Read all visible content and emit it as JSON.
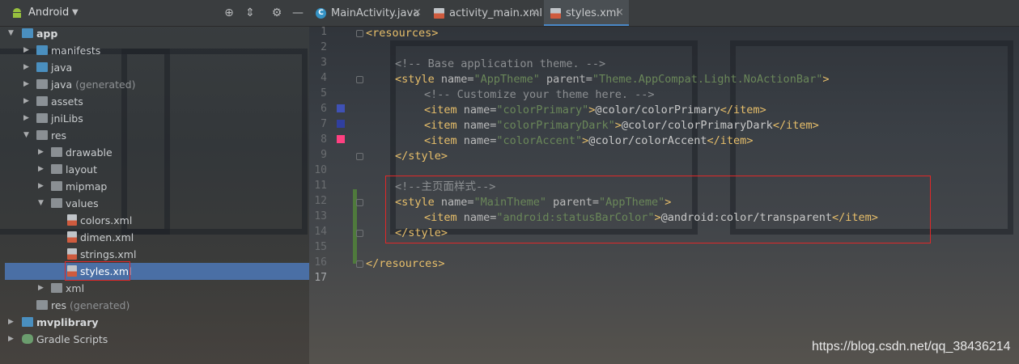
{
  "project_panel": {
    "view_label": "Android",
    "tree": [
      {
        "label": "app",
        "suffix": "",
        "bold": true
      },
      {
        "label": "manifests",
        "suffix": ""
      },
      {
        "label": "java",
        "suffix": ""
      },
      {
        "label": "java",
        "suffix": " (generated)"
      },
      {
        "label": "assets",
        "suffix": ""
      },
      {
        "label": "jniLibs",
        "suffix": ""
      },
      {
        "label": "res",
        "suffix": ""
      },
      {
        "label": "drawable",
        "suffix": ""
      },
      {
        "label": "layout",
        "suffix": ""
      },
      {
        "label": "mipmap",
        "suffix": ""
      },
      {
        "label": "values",
        "suffix": ""
      },
      {
        "label": "colors.xml",
        "suffix": ""
      },
      {
        "label": "dimen.xml",
        "suffix": ""
      },
      {
        "label": "strings.xml",
        "suffix": ""
      },
      {
        "label": "styles.xml",
        "suffix": ""
      },
      {
        "label": "xml",
        "suffix": ""
      },
      {
        "label": "res",
        "suffix": " (generated)"
      },
      {
        "label": "mvplibrary",
        "suffix": "",
        "bold": true
      },
      {
        "label": "Gradle Scripts",
        "suffix": ""
      }
    ]
  },
  "editor": {
    "tabs": [
      {
        "label": "MainActivity.java",
        "icon": "java-class-icon"
      },
      {
        "label": "activity_main.xml",
        "icon": "xml-file-icon"
      },
      {
        "label": "styles.xml",
        "icon": "xml-file-icon",
        "active": true
      }
    ],
    "line_numbers": [
      "1",
      "2",
      "3",
      "4",
      "5",
      "6",
      "7",
      "8",
      "9",
      "10",
      "11",
      "12",
      "13",
      "14",
      "15",
      "16",
      "17"
    ],
    "swatch_colors": [
      "#3f51b5",
      "#303f9f",
      "#ff4081"
    ],
    "code": {
      "l1_open": "<resources>",
      "l3_comment": "<!-- Base application theme. -->",
      "l4_tag": "<style ",
      "l4_a1": "name=",
      "l4_v1": "\"AppTheme\"",
      "l4_a2": " parent=",
      "l4_v2": "\"Theme.AppCompat.Light.NoActionBar\"",
      "l4_end": ">",
      "l5_comment": "<!-- Customize your theme here. -->",
      "item_open": "<item ",
      "item_attr": "name=",
      "l6_v": "\"colorPrimary\"",
      "l6_txt": "@color/colorPrimary",
      "l7_v": "\"colorPrimaryDark\"",
      "l7_txt": "@color/colorPrimaryDark",
      "l8_v": "\"colorAccent\"",
      "l8_txt": "@color/colorAccent",
      "item_close": "</item>",
      "gt": ">",
      "l9_close": "</style>",
      "l11_comment": "<!--主页面样式-->",
      "l12_v1": "\"MainTheme\"",
      "l12_v2": "\"AppTheme\"",
      "l13_v": "\"android:statusBarColor\"",
      "l13_txt": "@android:color/transparent",
      "l14_close": "</style>",
      "l16_close": "</resources>"
    }
  },
  "watermark": "https://blog.csdn.net/qq_38436214"
}
